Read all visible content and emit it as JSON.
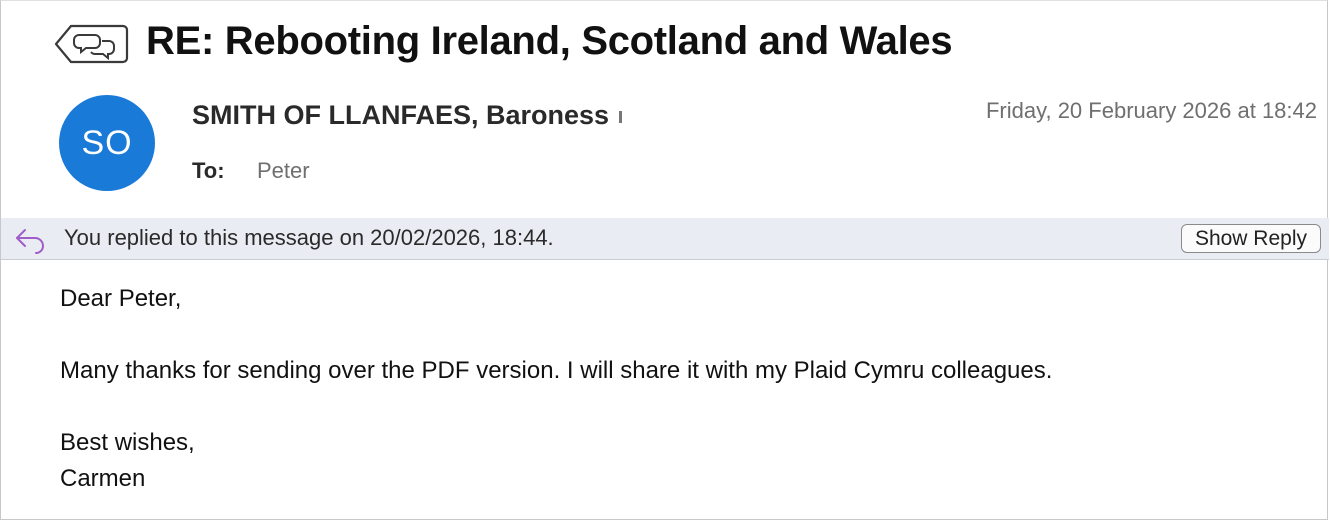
{
  "email": {
    "subject": "RE: Rebooting Ireland, Scotland and Wales",
    "thread_icon": "conversation-thread-icon",
    "avatar_initials": "SO",
    "avatar_color": "#1a7ad8",
    "sender": "SMITH OF LLANFAES, Baroness",
    "date": "Friday, 20 February 2026 at 18:42",
    "to_label": "To:",
    "to_value": "Peter"
  },
  "reply_bar": {
    "icon": "reply-arrow-icon",
    "text": "You replied to this message on 20/02/2026, 18:44.",
    "button_label": "Show Reply",
    "background": "#e9ecf3"
  },
  "body": {
    "greeting": "Dear Peter,",
    "paragraph": "Many thanks for sending over the PDF version. I will share it with my Plaid Cymru colleagues.",
    "closing": "Best wishes,",
    "signature": "Carmen"
  }
}
